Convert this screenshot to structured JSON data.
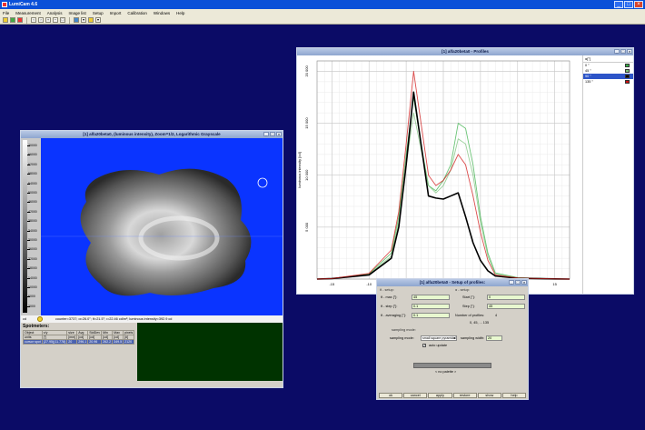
{
  "app": {
    "title": "LumiCam 4.6"
  },
  "menu": [
    "File",
    "Measurement",
    "Analysis",
    "Image list",
    "Setup",
    "Import",
    "Calibration",
    "Windows",
    "Help"
  ],
  "image_window": {
    "title": "[1] alfa20beta0, (luminous intensity), Zoom=1/2, Logarithmic Grayscale",
    "scale_labels": [
      "70000",
      "66000",
      "62000",
      "58000",
      "54000",
      "50000",
      "46000",
      "42000",
      "38000",
      "34000",
      "30000",
      "26000",
      "22000",
      "18000",
      "14000",
      "10000",
      "6000",
      "2000"
    ],
    "unit": "cd",
    "cursor_text": "counter=3737; α=26.0°; θ=21.5°; ι=22.46 cd/m²; luminous intensity=392.9 cd",
    "spotmeters": {
      "title": "Spotmeters:",
      "headers": [
        "Object",
        "x/y",
        "size",
        "Avg",
        "StdDev",
        "Min",
        "Max",
        "pixels"
      ],
      "units": [
        "units",
        "[°]",
        "[mm]",
        "[cd]",
        "[cd]",
        "[cd]",
        "[cd]",
        "[#]"
      ],
      "row": [
        "cursor spot",
        "(27.95)(11.778)",
        "20",
        "296.1",
        "20.96",
        "262.2",
        "349.5",
        "2120"
      ]
    }
  },
  "profiles_window": {
    "title": "[1] alfa20beta0 - Profiles",
    "legend_header": "α[°]",
    "legend": [
      {
        "label": "0 °",
        "color": "#38b048"
      },
      {
        "label": "45 °",
        "color": "#7ac27a"
      },
      {
        "label": "90 °",
        "color": "#000000"
      },
      {
        "label": "135 °",
        "color": "#d01010"
      }
    ],
    "selected_index": 2,
    "chart_data": {
      "type": "line",
      "xlabel": "θ[°]",
      "ylabel": "luminous intensity [cd]",
      "xlim": [
        -17,
        17
      ],
      "ylim": [
        0,
        21000
      ],
      "x_ticks": [
        "-15",
        "-10",
        "-5",
        "0",
        "5",
        "10",
        "15"
      ],
      "y_ticks": [
        "5 000",
        "10 000",
        "15 000",
        "20 000"
      ],
      "series": [
        {
          "name": "0 °",
          "color": "#38b048",
          "x": [
            -17,
            -15,
            -10,
            -7,
            -6,
            -5,
            -4,
            -3,
            -2,
            -1,
            0,
            1,
            2,
            3,
            4,
            5,
            6,
            7,
            10,
            15,
            17
          ],
          "y": [
            0,
            50,
            500,
            2500,
            6000,
            12000,
            17500,
            13000,
            9000,
            8500,
            9500,
            11000,
            15000,
            14500,
            11000,
            6000,
            2500,
            600,
            150,
            20,
            0
          ]
        },
        {
          "name": "45 °",
          "color": "#7ac27a",
          "x": [
            -17,
            -15,
            -10,
            -7,
            -6,
            -5,
            -4,
            -3,
            -2,
            -1,
            0,
            1,
            2,
            3,
            4,
            5,
            6,
            7,
            10,
            15,
            17
          ],
          "y": [
            0,
            50,
            450,
            2200,
            5500,
            11000,
            16000,
            12500,
            9000,
            8300,
            9000,
            10500,
            13500,
            13000,
            10000,
            5500,
            2200,
            500,
            120,
            20,
            0
          ]
        },
        {
          "name": "90 °",
          "color": "#000000",
          "x": [
            -17,
            -15,
            -10,
            -7,
            -6,
            -5,
            -4,
            -3,
            -2,
            -1,
            0,
            1,
            2,
            3,
            4,
            5,
            6,
            7,
            10,
            15,
            17
          ],
          "y": [
            0,
            50,
            400,
            2000,
            5000,
            11000,
            18000,
            13000,
            8000,
            7800,
            7700,
            8000,
            8300,
            6000,
            3500,
            1800,
            800,
            300,
            80,
            20,
            0
          ]
        },
        {
          "name": "135 °",
          "color": "#d01010",
          "x": [
            -17,
            -15,
            -10,
            -7,
            -6,
            -5,
            -4,
            -3,
            -2,
            -1,
            0,
            1,
            2,
            3,
            4,
            5,
            6,
            7,
            10,
            15,
            17
          ],
          "y": [
            0,
            50,
            550,
            2800,
            6500,
            13000,
            20000,
            15000,
            10000,
            9000,
            9500,
            10500,
            12000,
            11000,
            8000,
            4500,
            1800,
            400,
            100,
            20,
            0
          ]
        }
      ]
    }
  },
  "setup_window": {
    "title": "[1] alfa20beta0 - Setup of profiles:",
    "theta_group": "θ - setup:",
    "alpha_group": "α - setup:",
    "theta_max_label": "θ - max [°]:",
    "theta_max": "45",
    "theta_step_label": "θ - step [°]:",
    "theta_step": "0.1",
    "theta_avg_label": "θ - averaging [°]:",
    "theta_avg": "0.1",
    "alpha_start_label": "Start [°]:",
    "alpha_start": "0",
    "alpha_step_label": "Step [°]:",
    "alpha_step": "45",
    "num_profiles_label": "Number of profiles:",
    "num_profiles": "4",
    "alpha_list": "0, 45, ... 135",
    "sampling_group": "sampling mode:",
    "sampling_mode_label": "sampling mode:",
    "sampling_mode": "small square pyramidal",
    "sampling_width_label": "sampling width:",
    "sampling_width": "20",
    "auto_update": "auto update",
    "palette_label": "< no palette >",
    "buttons": [
      "ok",
      "cancel",
      "apply",
      "restore",
      "show",
      "help"
    ]
  }
}
